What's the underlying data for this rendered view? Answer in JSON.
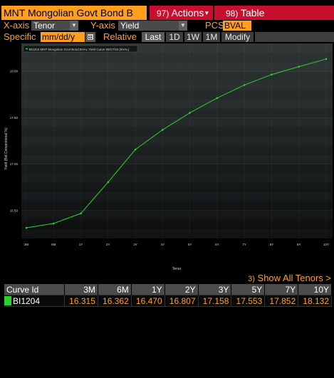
{
  "header": {
    "title": "MNT Mongolian Govt Bond B",
    "actions_num": "97)",
    "actions_label": "Actions",
    "table_num": "98)",
    "table_label": "Table"
  },
  "controls": {
    "xaxis_label": "X-axis",
    "xaxis_value": "Tenor",
    "yaxis_label": "Y-axis",
    "yaxis_value": "Yield",
    "pcs_label": "PCS",
    "pcs_value": "BVAL",
    "specific_label": "Specific",
    "date_placeholder": "mm/dd/y",
    "relative_label": "Relative",
    "buttons": [
      "Last",
      "1D",
      "1W",
      "1M",
      "Modify"
    ]
  },
  "chart_data": {
    "type": "line",
    "legend": "BI1204 MNT Mongolian Govt Bond BVAL Yield Curve 09/17/15 (BVAL)",
    "xlabel": "Tenor",
    "ylabel": "Yield (Bid Conventional %)",
    "categories": [
      "3M",
      "6M",
      "1Y",
      "2Y",
      "3Y",
      "4Y",
      "5Y",
      "6Y",
      "7Y",
      "8Y",
      "9Y",
      "10Y"
    ],
    "series": [
      {
        "name": "BI1204",
        "color": "#2bd12b",
        "values": [
          16.315,
          16.362,
          16.47,
          16.807,
          17.158,
          17.37,
          17.553,
          17.712,
          17.852,
          17.965,
          18.05,
          18.132
        ]
      }
    ],
    "yticks": [
      "16.50",
      "17.00",
      "17.50",
      "18.00"
    ],
    "ylim": [
      16.2,
      18.3
    ],
    "grid": true
  },
  "show_all": {
    "num": "3)",
    "label": "Show All Tenors >"
  },
  "table": {
    "headers": [
      "Curve Id",
      "3M",
      "6M",
      "1Y",
      "2Y",
      "3Y",
      "5Y",
      "7Y",
      "10Y"
    ],
    "rows": [
      {
        "id": "BI1204",
        "color": "#2bd12b",
        "values": [
          "16.315",
          "16.362",
          "16.470",
          "16.807",
          "17.158",
          "17.553",
          "17.852",
          "18.132"
        ]
      }
    ]
  }
}
